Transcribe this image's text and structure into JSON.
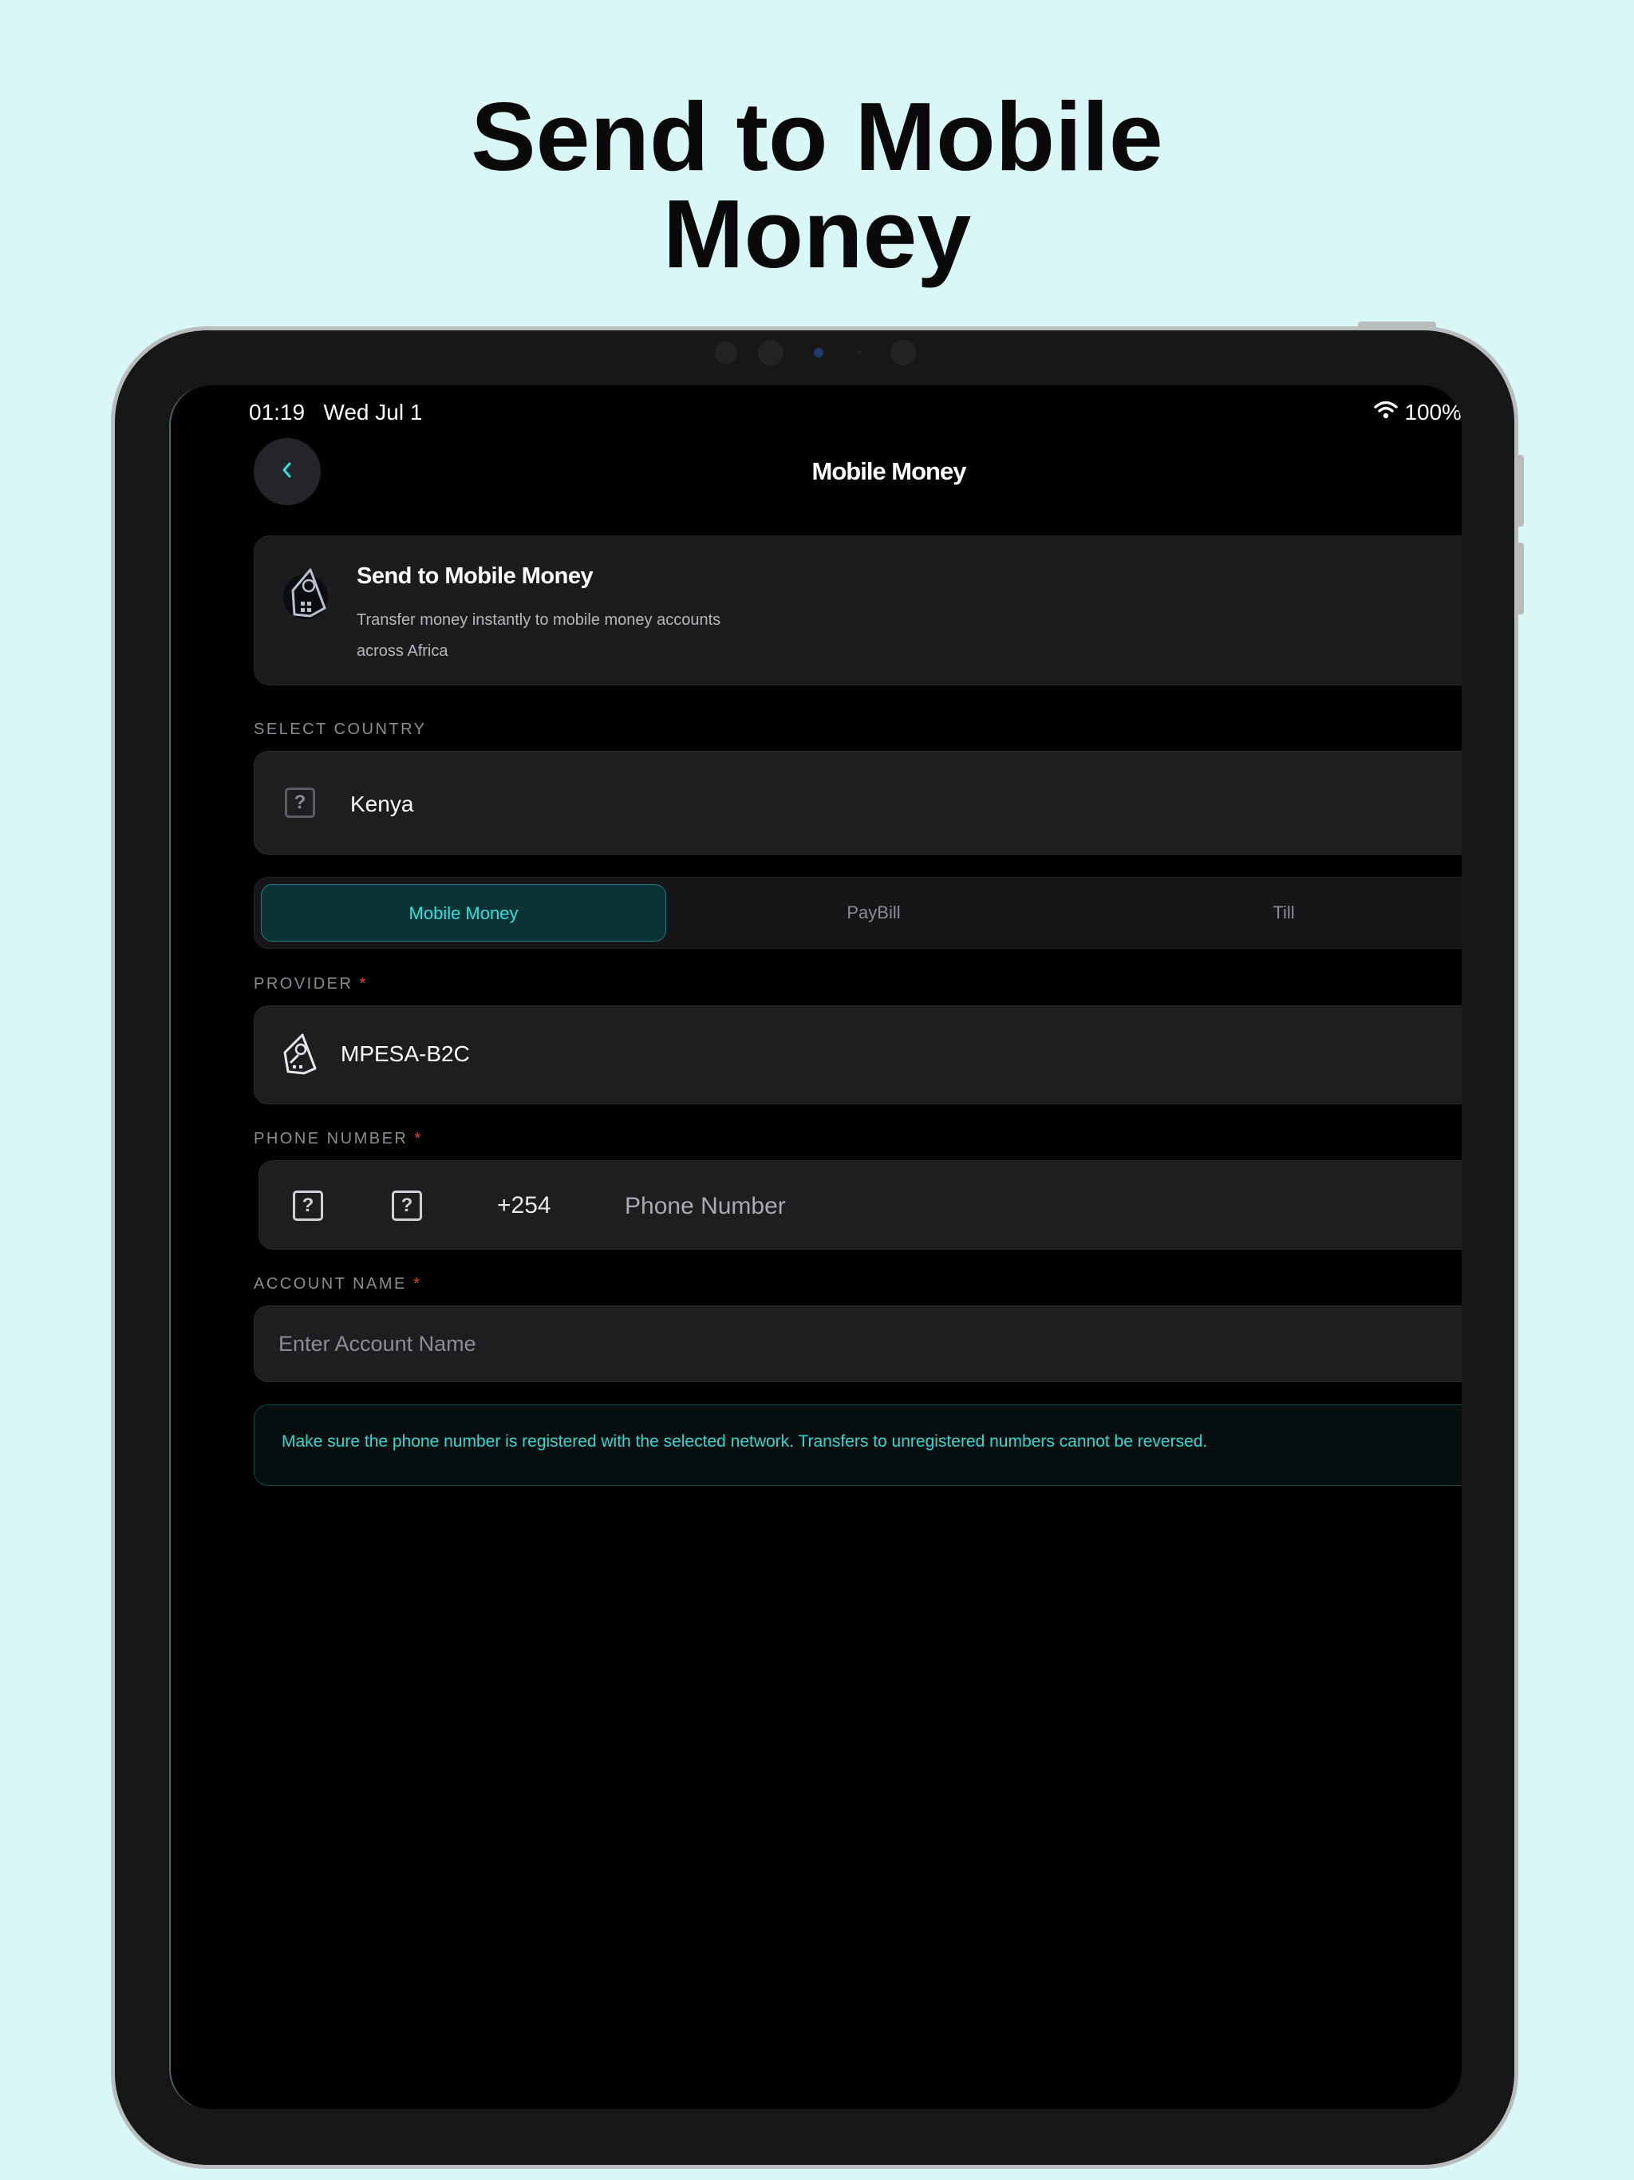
{
  "headline": {
    "line1": "Send to Mobile",
    "line2": "Money"
  },
  "status_bar": {
    "time": "01:19",
    "date": "Wed Jul 1",
    "battery": "100%"
  },
  "nav": {
    "title": "Mobile Money"
  },
  "hero": {
    "title": "Send to Mobile Money",
    "subtitle_line1": "Transfer money instantly to mobile money accounts",
    "subtitle_line2": "across Africa"
  },
  "country": {
    "label": "SELECT COUNTRY",
    "value": "Kenya"
  },
  "tabs": [
    {
      "label": "Mobile Money",
      "active": true
    },
    {
      "label": "PayBill",
      "active": false
    },
    {
      "label": "Till",
      "active": false
    }
  ],
  "provider": {
    "label": "PROVIDER",
    "required": "*",
    "value": "MPESA-B2C"
  },
  "phone": {
    "label": "PHONE NUMBER",
    "required": "*",
    "code": "+254",
    "placeholder": "Phone Number"
  },
  "account": {
    "label": "ACCOUNT NAME",
    "required": "*",
    "placeholder": "Enter Account Name"
  },
  "notice": {
    "text": "Make sure the phone number is registered with the selected network. Transfers to unregistered numbers cannot be reversed."
  },
  "colors": {
    "accent": "#2ce3dd",
    "background": "#d9f7f7",
    "required": "#e0413b"
  },
  "icons": [
    "chevron-left-icon",
    "wifi-icon",
    "money-bag-icon",
    "chevron-up-icon",
    "placeholder-flag-icon"
  ]
}
